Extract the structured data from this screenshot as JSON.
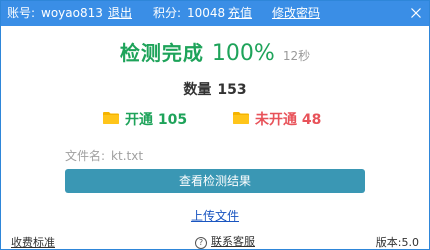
{
  "titlebar": {
    "account_label": "账号:",
    "account_value": "woyao813",
    "logout": "退出",
    "points_label": "积分:",
    "points_value": "10048",
    "recharge": "充值",
    "change_password": "修改密码",
    "colors": {
      "background": "#3a8ee6",
      "text": "#ffffff"
    }
  },
  "result": {
    "status": "检测完成",
    "percent": "100%",
    "elapsed": "12秒",
    "count_label": "数量",
    "count_value": "153",
    "opened_label": "开通",
    "opened_value": "105",
    "not_opened_label": "未开通",
    "not_opened_value": "48",
    "colors": {
      "success": "#1ea35a",
      "fail": "#e8535a",
      "folder": "#f5b400"
    }
  },
  "file": {
    "label": "文件名:",
    "value": "kt.txt"
  },
  "actions": {
    "view_results": "查看检测结果",
    "upload_file": "上传文件",
    "button_color": "#3a97b4"
  },
  "footer": {
    "pricing": "收费标准",
    "contact": "联系客服",
    "version": "版本:5.0"
  }
}
